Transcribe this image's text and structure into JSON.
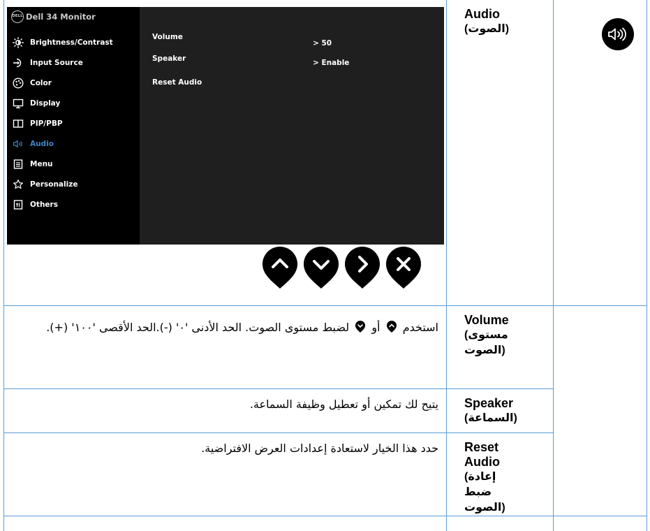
{
  "osd": {
    "brand": "DELL",
    "title": "Dell 34 Monitor",
    "menu": [
      {
        "label": "Brightness/Contrast",
        "icon": "brightness-icon"
      },
      {
        "label": "Input Source",
        "icon": "input-source-icon"
      },
      {
        "label": "Color",
        "icon": "color-palette-icon"
      },
      {
        "label": "Display",
        "icon": "display-icon"
      },
      {
        "label": "PIP/PBP",
        "icon": "pip-pbp-icon"
      },
      {
        "label": "Audio",
        "icon": "speaker-icon",
        "active": true
      },
      {
        "label": "Menu",
        "icon": "menu-icon"
      },
      {
        "label": "Personalize",
        "icon": "star-icon"
      },
      {
        "label": "Others",
        "icon": "others-icon"
      }
    ],
    "settings": [
      {
        "label": "Volume",
        "value": "> 50"
      },
      {
        "label": "Speaker",
        "value": "> Enable"
      },
      {
        "label": "Reset Audio",
        "value": ""
      }
    ],
    "nav_buttons": [
      "chevron-up-icon",
      "chevron-down-icon",
      "chevron-right-icon",
      "close-icon"
    ]
  },
  "table": {
    "header": {
      "en": "Audio",
      "ar": "(الصوت)"
    },
    "rows": [
      {
        "en": "Volume",
        "ar": "(مستوى الصوت)",
        "desc_part1": "استخدم",
        "desc_part2": "أو",
        "desc_part3": "لضبط مستوى الصوت. الحد الأدنى '٠' (-).الحد الأقصى '١٠٠' (+)."
      },
      {
        "en": "Speaker",
        "ar": "(السماعة)",
        "desc": "يتيح لك تمكين أو تعطيل وظيفة السماعة."
      },
      {
        "en": "Reset Audio",
        "ar": "(إعادة ضبط الصوت)",
        "desc": "حدد هذا الخيار لاستعادة إعدادات العرض الافتراضية."
      }
    ]
  },
  "colors": {
    "border": "#5b9bd5",
    "active": "#3f84c8",
    "osd_bg": "#1f1f1f"
  }
}
